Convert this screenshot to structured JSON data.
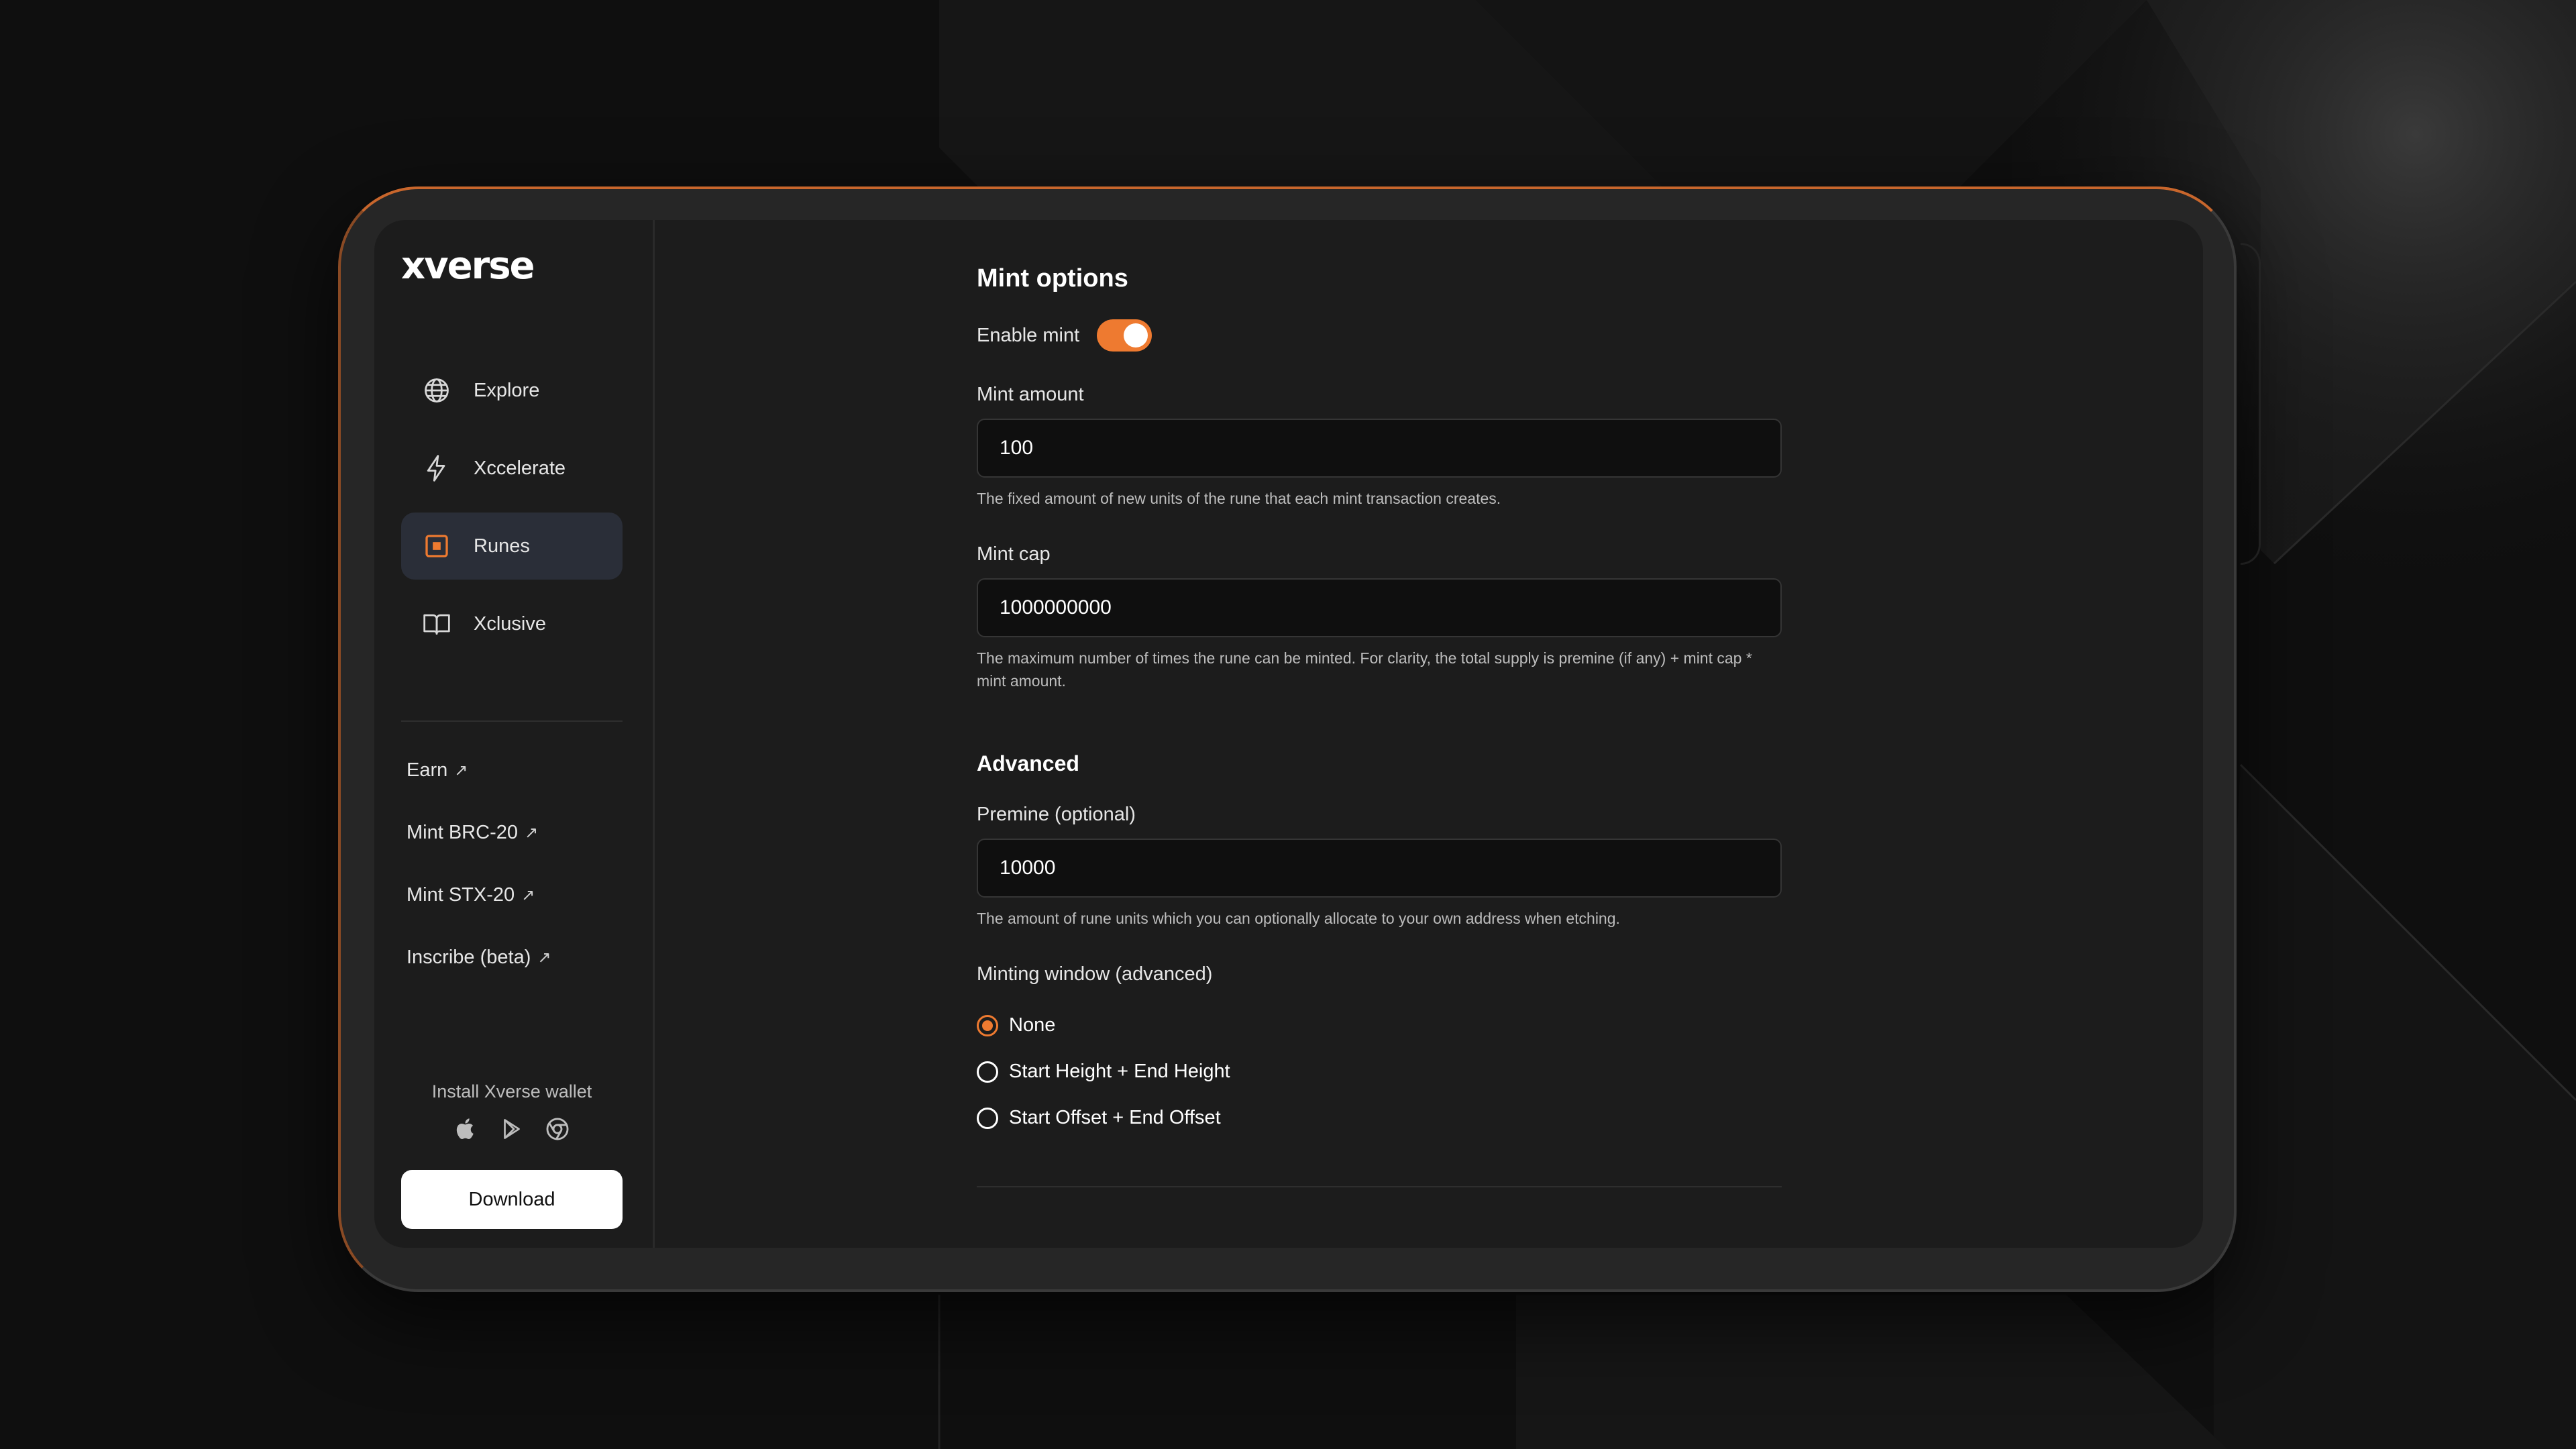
{
  "colors": {
    "accent": "#ee7a30",
    "background": "#0f0f0f",
    "screen": "#1c1c1c",
    "active_nav": "#2a2e38"
  },
  "brand": {
    "logo": "xverse"
  },
  "sidebar": {
    "nav": [
      {
        "label": "Explore",
        "icon": "globe-icon",
        "active": false
      },
      {
        "label": "Xccelerate",
        "icon": "lightning-icon",
        "active": false
      },
      {
        "label": "Runes",
        "icon": "runes-icon",
        "active": true
      },
      {
        "label": "Xclusive",
        "icon": "book-icon",
        "active": false
      }
    ],
    "links": [
      {
        "label": "Earn"
      },
      {
        "label": "Mint BRC-20"
      },
      {
        "label": "Mint STX-20"
      },
      {
        "label": "Inscribe (beta)"
      }
    ],
    "install_text": "Install Xverse wallet",
    "store_icons": [
      "apple-icon",
      "google-play-icon",
      "chrome-icon"
    ],
    "download_label": "Download"
  },
  "main": {
    "mint_options_title": "Mint options",
    "enable_mint_label": "Enable mint",
    "enable_mint_on": true,
    "mint_amount": {
      "label": "Mint amount",
      "value": "100",
      "hint": "The fixed amount of new units of the rune that each mint transaction creates."
    },
    "mint_cap": {
      "label": "Mint cap",
      "value": "1000000000",
      "hint": "The maximum number of times the rune can be minted. For clarity, the total supply is premine (if any) + mint cap * mint amount."
    },
    "advanced_title": "Advanced",
    "premine": {
      "label": "Premine (optional)",
      "value": "10000",
      "hint": "The amount of rune units which you can optionally allocate to your own address when etching."
    },
    "minting_window": {
      "label": "Minting window (advanced)",
      "options": [
        {
          "label": "None",
          "selected": true
        },
        {
          "label": "Start Height + End Height",
          "selected": false
        },
        {
          "label": "Start Offset + End Offset",
          "selected": false
        }
      ]
    }
  }
}
